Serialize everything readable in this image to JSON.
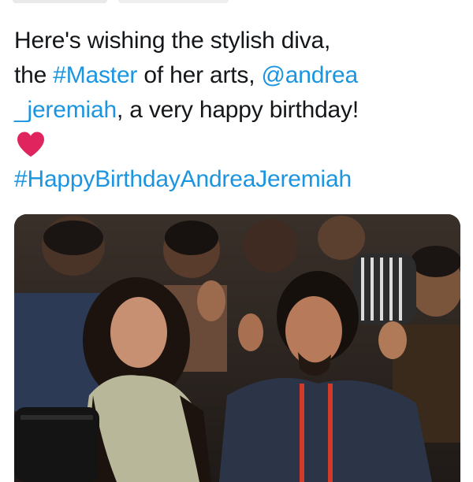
{
  "tweet": {
    "line1": "Here's wishing the stylish diva,",
    "line2_pre": "the ",
    "hashtag_master": "#Master",
    "line2_mid": " of her arts, ",
    "mention_part1": "@andrea",
    "mention_part2": "_jeremiah",
    "line3_post": ", a very happy birthday!",
    "heart_icon": "red-heart-icon",
    "hashtag_birthday": "#HappyBirthdayAndreaJeremiah"
  },
  "colors": {
    "link": "#1b95e0",
    "text": "#14171a",
    "heart": "#e0245e"
  },
  "media": {
    "alt": "photo"
  }
}
